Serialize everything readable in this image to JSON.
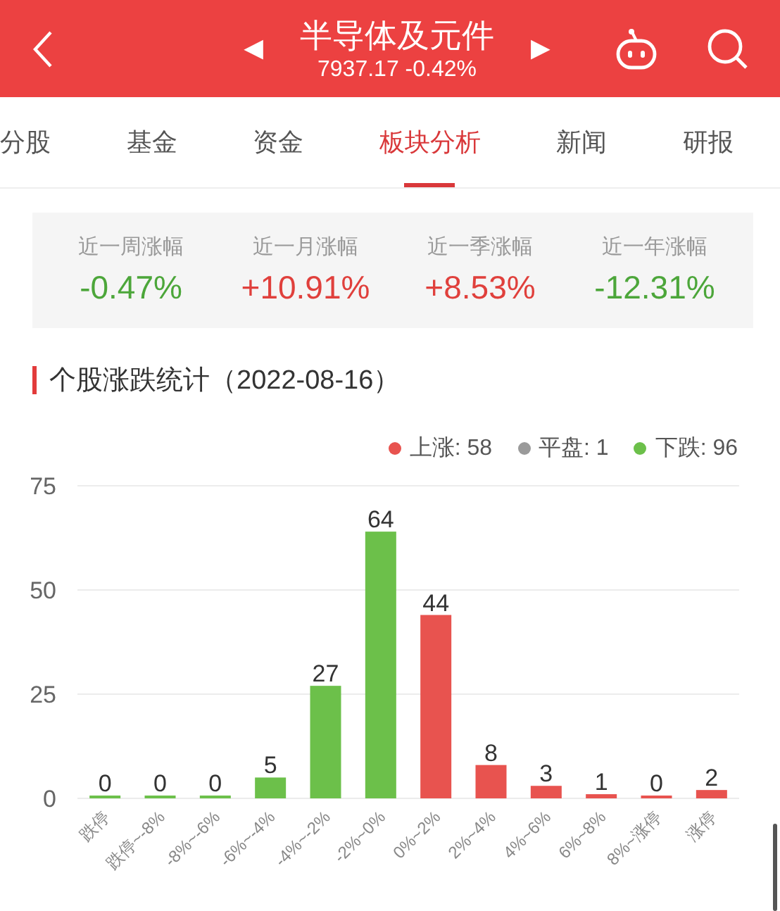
{
  "header": {
    "title": "半导体及元件",
    "quote": "7937.17 -0.42%",
    "prev_symbol": "◀",
    "next_symbol": "▶"
  },
  "tabs": [
    {
      "label": "分股",
      "selected": false
    },
    {
      "label": "基金",
      "selected": false
    },
    {
      "label": "资金",
      "selected": false
    },
    {
      "label": "板块分析",
      "selected": true
    },
    {
      "label": "新闻",
      "selected": false
    },
    {
      "label": "研报",
      "selected": false
    }
  ],
  "returns": [
    {
      "label": "近一周涨幅",
      "value": "-0.47%",
      "color": "#4ca63a"
    },
    {
      "label": "近一月涨幅",
      "value": "+10.91%",
      "color": "#e0403c"
    },
    {
      "label": "近一季涨幅",
      "value": "+8.53%",
      "color": "#e0403c"
    },
    {
      "label": "近一年涨幅",
      "value": "-12.31%",
      "color": "#4ca63a"
    }
  ],
  "section_title": "个股涨跌统计（2022-08-16）",
  "legend": [
    {
      "label": "上涨: 58",
      "color": "#e8534f"
    },
    {
      "label": "平盘: 1",
      "color": "#9a9a9a"
    },
    {
      "label": "下跌: 96",
      "color": "#6cc04a"
    }
  ],
  "chart_data": {
    "type": "bar",
    "categories": [
      "跌停",
      "跌停~-8%",
      "-8%~-6%",
      "-6%~-4%",
      "-4%~-2%",
      "-2%~0%",
      "0%~2%",
      "2%~4%",
      "4%~6%",
      "6%~8%",
      "8%~涨停",
      "涨停"
    ],
    "series": [
      {
        "color": "#6cc04a",
        "values": [
          0,
          0,
          0,
          5,
          27,
          64,
          null,
          null,
          null,
          null,
          null,
          null
        ]
      },
      {
        "color": "#e8534f",
        "values": [
          null,
          null,
          null,
          null,
          null,
          null,
          44,
          8,
          3,
          1,
          0,
          2
        ]
      }
    ],
    "ylim": [
      0,
      75
    ],
    "yticks": [
      0,
      25,
      50,
      75
    ],
    "data_labels": true
  }
}
